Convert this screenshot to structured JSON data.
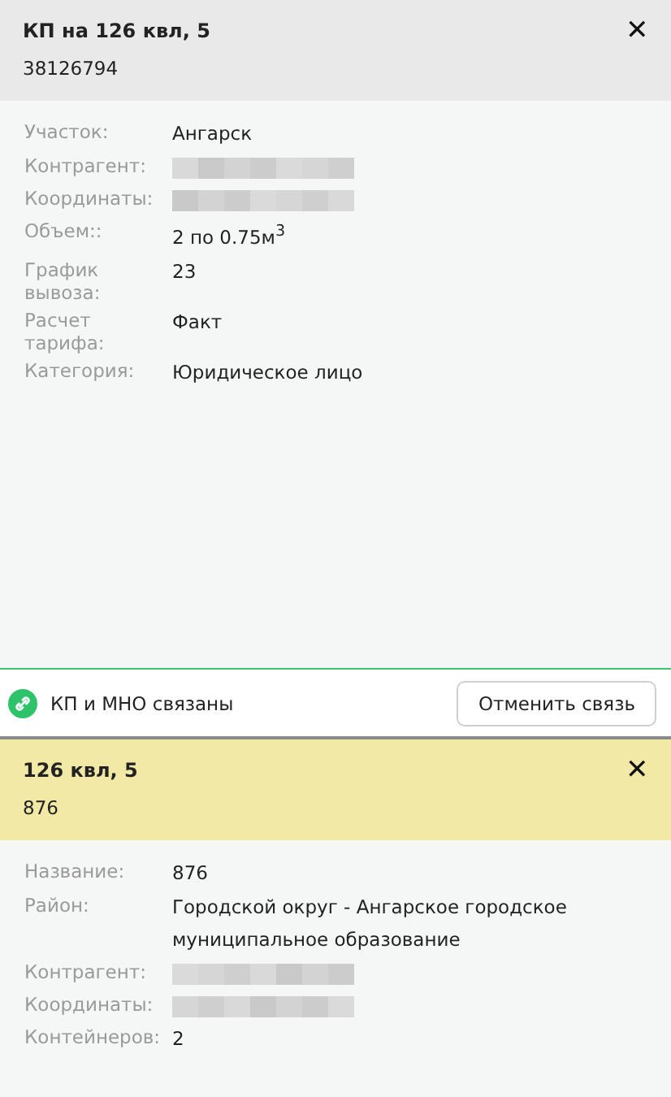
{
  "point": {
    "title": "КП на 126 квл, 5",
    "subtitle": "38126794",
    "close": "✕",
    "fields": [
      {
        "kind": "text",
        "label": "Участок:",
        "value": "Ангарск"
      },
      {
        "kind": "redacted",
        "label": "Контрагент:"
      },
      {
        "kind": "redacted",
        "label": "Координаты:"
      },
      {
        "kind": "text",
        "label": "Объем::",
        "value": "2 по 0.75м$^{3}$"
      },
      {
        "kind": "text",
        "label": "График вывоза:",
        "value": "23"
      },
      {
        "kind": "text",
        "label": "Расчет тарифа:",
        "value": "Факт"
      },
      {
        "kind": "text",
        "label": "Категория:",
        "value": "Юридическое лицо"
      }
    ]
  },
  "link": {
    "status": "КП и МНО связаны",
    "button": "Отменить связь"
  },
  "site": {
    "title": "126 квл, 5",
    "subtitle": "876",
    "close": "✕",
    "fields": [
      {
        "kind": "text",
        "label": "Название:",
        "value": "876"
      },
      {
        "kind": "text",
        "label": "Район:",
        "value": "Городской округ - Ангарское городское муниципальное образование"
      },
      {
        "kind": "redacted",
        "label": "Контрагент:"
      },
      {
        "kind": "redacted",
        "label": "Координаты:"
      },
      {
        "kind": "text",
        "label": "Контейнеров:",
        "value": "2"
      }
    ]
  }
}
